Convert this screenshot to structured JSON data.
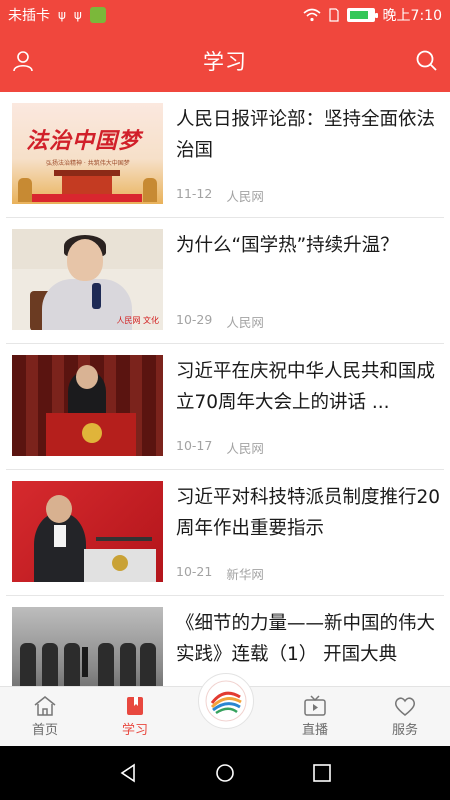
{
  "status_bar": {
    "carrier": "未插卡",
    "time": "晚上7:10",
    "usb_icons": [
      "ψ",
      "ψ"
    ],
    "battery_level": 0.75
  },
  "header": {
    "title": "学习",
    "left_icon": "user-icon",
    "right_icon": "search-icon"
  },
  "news": [
    {
      "title": "人民日报评论部：坚持全面依法治国",
      "date": "11-12",
      "source": "人民网",
      "thumb": {
        "title": "法治中国梦",
        "sub": "弘扬法治精神 · 共筑伟大中国梦"
      }
    },
    {
      "title": "为什么“国学热”持续升温？",
      "date": "10-29",
      "source": "人民网",
      "thumb": {
        "logo": "人民网 文化"
      }
    },
    {
      "title": "习近平在庆祝中华人民共和国成立70周年大会上的讲话 ...",
      "date": "10-17",
      "source": "人民网",
      "thumb": {}
    },
    {
      "title": "习近平对科技特派员制度推行20周年作出重要指示",
      "date": "10-21",
      "source": "新华网",
      "thumb": {}
    },
    {
      "title": "《细节的力量——新中国的伟大实践》连载（1） 开国大典",
      "date": "",
      "source": "",
      "thumb": {}
    }
  ],
  "bottom_nav": [
    {
      "label": "首页",
      "icon": "home-icon",
      "active": false
    },
    {
      "label": "学习",
      "icon": "book-icon",
      "active": true
    },
    {
      "label": "",
      "icon": "app-logo-icon",
      "active": false
    },
    {
      "label": "直播",
      "icon": "tv-icon",
      "active": false
    },
    {
      "label": "服务",
      "icon": "heart-icon",
      "active": false
    }
  ],
  "colors": {
    "brand": "#f0473d",
    "active_nav": "#e8483f",
    "meta_text": "#a3a3a3"
  }
}
